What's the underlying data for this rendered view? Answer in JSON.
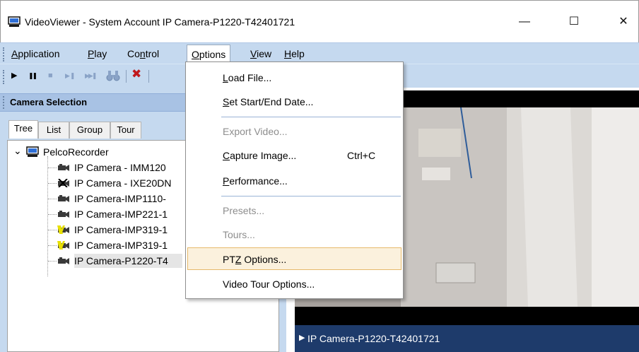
{
  "window": {
    "title": "VideoViewer - System Account IP Camera-P1220-T42401721",
    "minimize": "—",
    "maximize": "☐",
    "close": "✕"
  },
  "menubar": {
    "items": [
      {
        "pre": "",
        "key": "A",
        "post": "pplication"
      },
      {
        "pre": "",
        "key": "P",
        "post": "lay"
      },
      {
        "pre": "Co",
        "key": "n",
        "post": "trol"
      },
      {
        "pre": "",
        "key": "O",
        "post": "ptions"
      },
      {
        "pre": "",
        "key": "V",
        "post": "iew"
      },
      {
        "pre": "",
        "key": "H",
        "post": "elp"
      }
    ]
  },
  "toolbar": {
    "play": "▶",
    "pause": "❚❚",
    "stop": "■",
    "step_pause": "▶❚",
    "step_fwd": "▶▶❚",
    "binoculars": "👓",
    "delete": "✖",
    "colors": {
      "delete": "#c0181c",
      "disabled": "#8aa3c7"
    }
  },
  "panel": {
    "title": "Camera Selection",
    "tabs": [
      "Tree",
      "List",
      "Group",
      "Tour"
    ],
    "active_tab": "Tree"
  },
  "tree": {
    "root": "PelcoRecorder",
    "expander": "⌄",
    "items": [
      {
        "label": "IP Camera - IMM120",
        "state": "normal"
      },
      {
        "label": "IP Camera - IXE20DN",
        "state": "offline"
      },
      {
        "label": "IP Camera-IMP1110-",
        "state": "normal"
      },
      {
        "label": "IP Camera-IMP221-1",
        "state": "normal"
      },
      {
        "label": "IP Camera-IMP319-1",
        "state": "warning"
      },
      {
        "label": "IP Camera-IMP319-1",
        "state": "warning"
      },
      {
        "label": "IP Camera-P1220-T4",
        "state": "selected"
      }
    ]
  },
  "options_menu": {
    "items": [
      {
        "pre": "",
        "key": "L",
        "post": "oad File...",
        "shortcut": "",
        "state": "normal"
      },
      {
        "pre": "",
        "key": "S",
        "post": "et Start/End Date...",
        "shortcut": "",
        "state": "normal"
      },
      {
        "pre": "Export Video...",
        "key": "",
        "post": "",
        "shortcut": "",
        "state": "disabled"
      },
      {
        "pre": "",
        "key": "C",
        "post": "apture Image...",
        "shortcut": "Ctrl+C",
        "state": "normal"
      },
      {
        "pre": "",
        "key": "P",
        "post": "erformance...",
        "shortcut": "",
        "state": "normal"
      },
      {
        "pre": "Presets...",
        "key": "",
        "post": "",
        "shortcut": "",
        "state": "disabled"
      },
      {
        "pre": "Tours...",
        "key": "",
        "post": "",
        "shortcut": "",
        "state": "disabled"
      },
      {
        "pre": "PT",
        "key": "Z",
        "post": " Options...",
        "shortcut": "",
        "state": "hover"
      },
      {
        "pre": "Video Tour Options...",
        "key": "",
        "post": "",
        "shortcut": "",
        "state": "normal"
      }
    ]
  },
  "video": {
    "camera_label": "IP Camera-P1220-T42401721",
    "arrow": "▶"
  },
  "colors": {
    "menubar_bg": "#c5d9ef",
    "panel_header_bg": "#a8c2e4",
    "video_label_bg": "#1e3b6b",
    "menu_hover_bg": "#fbf1dd",
    "menu_hover_border": "#e6b96b"
  }
}
